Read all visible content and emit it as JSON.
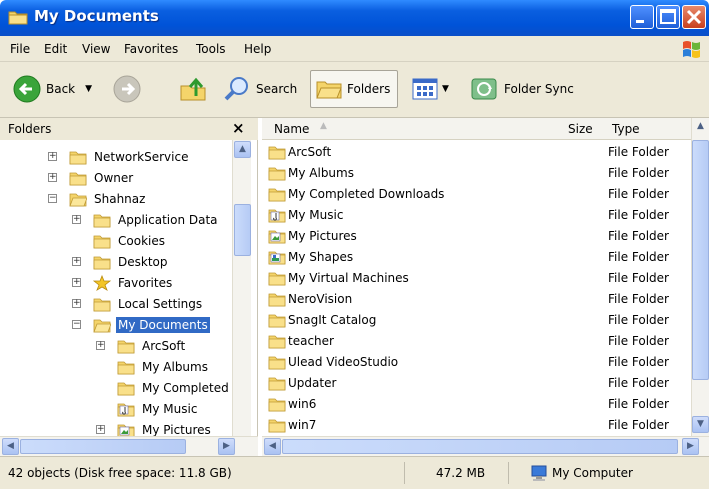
{
  "window": {
    "title": "My Documents"
  },
  "menu": [
    "File",
    "Edit",
    "View",
    "Favorites",
    "Tools",
    "Help"
  ],
  "toolbar": {
    "back_label": "Back",
    "search_label": "Search",
    "folders_label": "Folders",
    "folder_sync_label": "Folder Sync"
  },
  "folders_pane": {
    "title": "Folders",
    "close_glyph": "×",
    "items": [
      {
        "label": "NetworkService",
        "expander": "+",
        "icon": "folder-icon"
      },
      {
        "label": "Owner",
        "expander": "+",
        "icon": "folder-icon"
      },
      {
        "label": "Shahnaz",
        "expander": "−",
        "icon": "open-folder-icon"
      },
      {
        "label": "Application Data",
        "expander": "+",
        "icon": "folder-icon"
      },
      {
        "label": "Cookies",
        "expander": "",
        "icon": "folder-icon"
      },
      {
        "label": "Desktop",
        "expander": "+",
        "icon": "folder-icon"
      },
      {
        "label": "Favorites",
        "expander": "+",
        "icon": "star-icon"
      },
      {
        "label": "Local Settings",
        "expander": "+",
        "icon": "folder-icon"
      },
      {
        "label": "My Documents",
        "expander": "−",
        "icon": "open-folder-icon",
        "selected": true
      },
      {
        "label": "ArcSoft",
        "expander": "+",
        "icon": "folder-icon"
      },
      {
        "label": "My Albums",
        "expander": "",
        "icon": "folder-icon"
      },
      {
        "label": "My Completed Di",
        "expander": "",
        "icon": "folder-icon"
      },
      {
        "label": "My Music",
        "expander": "",
        "icon": "music-folder-icon"
      },
      {
        "label": "My Pictures",
        "expander": "+",
        "icon": "pictures-folder-icon"
      }
    ]
  },
  "list": {
    "columns": {
      "name": "Name",
      "size": "Size",
      "type": "Type"
    },
    "rows": [
      {
        "name": "ArcSoft",
        "type": "File Folder",
        "icon": "folder-icon"
      },
      {
        "name": "My Albums",
        "type": "File Folder",
        "icon": "folder-icon"
      },
      {
        "name": "My Completed Downloads",
        "type": "File Folder",
        "icon": "folder-icon"
      },
      {
        "name": "My Music",
        "type": "File Folder",
        "icon": "music-folder-icon"
      },
      {
        "name": "My Pictures",
        "type": "File Folder",
        "icon": "pictures-folder-icon"
      },
      {
        "name": "My Shapes",
        "type": "File Folder",
        "icon": "shapes-folder-icon"
      },
      {
        "name": "My Virtual Machines",
        "type": "File Folder",
        "icon": "folder-icon"
      },
      {
        "name": "NeroVision",
        "type": "File Folder",
        "icon": "folder-icon"
      },
      {
        "name": "SnagIt Catalog",
        "type": "File Folder",
        "icon": "folder-icon"
      },
      {
        "name": "teacher",
        "type": "File Folder",
        "icon": "folder-icon"
      },
      {
        "name": "Ulead VideoStudio",
        "type": "File Folder",
        "icon": "folder-icon"
      },
      {
        "name": "Updater",
        "type": "File Folder",
        "icon": "folder-icon"
      },
      {
        "name": "win6",
        "type": "File Folder",
        "icon": "folder-icon"
      },
      {
        "name": "win7",
        "type": "File Folder",
        "icon": "folder-icon"
      }
    ]
  },
  "statusbar": {
    "objects": "42 objects (Disk free space: 11.8 GB)",
    "size": "47.2 MB",
    "location": "My Computer"
  },
  "colors": {
    "title_bar": "#0053d8",
    "selection": "#316ac5",
    "chrome": "#ede9d8"
  }
}
